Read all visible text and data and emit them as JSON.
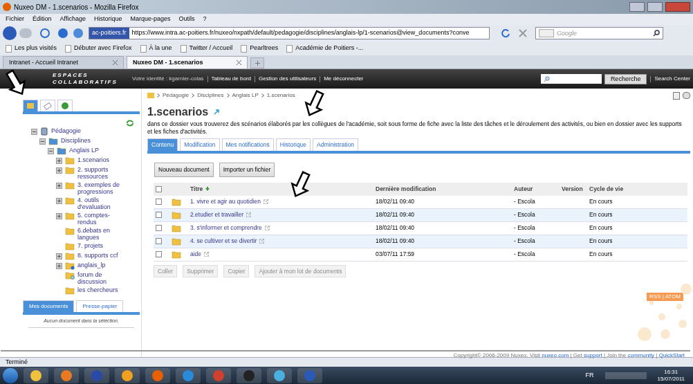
{
  "window": {
    "title": "Nuxeo DM - 1.scenarios - Mozilla Firefox"
  },
  "menu": [
    "Fichier",
    "Édition",
    "Affichage",
    "Historique",
    "Marque-pages",
    "Outils",
    "?"
  ],
  "address": {
    "site": "ac-poitiers.fr",
    "url": "https://www.intra.ac-poitiers.fr/nuxeo/nxpath/default/pedagogie/disciplines/anglais-lp/1-scenarios@view_documents?conve"
  },
  "search": {
    "placeholder": "Google"
  },
  "bookmarks": [
    "Les plus visités",
    "Débuter avec Firefox",
    "À la une",
    "Twitter / Accueil",
    "Pearltrees",
    "Académie de Poitiers -..."
  ],
  "browser_tabs": [
    {
      "label": "Intranet - Accueil Intranet",
      "selected": false
    },
    {
      "label": "Nuxeo DM - 1.scenarios",
      "selected": true
    }
  ],
  "header": {
    "logo": [
      "ESPACES",
      "COLLABORATIFS"
    ],
    "identity": "Votre identité : kgarnier-colas",
    "links": [
      "Tableau de bord",
      "Gestion des utilisateurs",
      "Me déconnecter"
    ],
    "search_button": "Recherche",
    "search_center": "Search Center"
  },
  "sidebar_tabs": [
    {
      "kind": "navigation",
      "selected": true
    },
    {
      "kind": "tags",
      "selected": false
    },
    {
      "kind": "web",
      "selected": false
    }
  ],
  "tree": [
    {
      "label": "Pédagogie",
      "kind": "workspace",
      "expanded": true,
      "children": [
        {
          "label": "Disciplines",
          "kind": "blue",
          "expanded": true,
          "children": [
            {
              "label": "Anglais LP",
              "kind": "blue",
              "expanded": true,
              "children": [
                {
                  "label": "1.scenarios",
                  "kind": "folder",
                  "expanded": false
                },
                {
                  "label": "2. supports ressources",
                  "kind": "folder",
                  "expanded": false
                },
                {
                  "label": "3. exemples de progressions",
                  "kind": "folder",
                  "expanded": false
                },
                {
                  "label": "4. outils d'evaluation",
                  "kind": "folder",
                  "expanded": false
                },
                {
                  "label": "5. comptes-rendus",
                  "kind": "folder",
                  "expanded": false
                },
                {
                  "label": "6.debats en langues",
                  "kind": "folder"
                },
                {
                  "label": "7. projets",
                  "kind": "folder"
                },
                {
                  "label": "8. supports ccf",
                  "kind": "folder",
                  "expanded": false
                },
                {
                  "label": "anglais_lp",
                  "kind": "web",
                  "expanded": false
                },
                {
                  "label": "forum de discussion",
                  "kind": "forum"
                },
                {
                  "label": "les chercheurs",
                  "kind": "folder"
                }
              ]
            }
          ]
        }
      ]
    }
  ],
  "bottom_tabs": [
    {
      "label": "Mes documents",
      "selected": true
    },
    {
      "label": "Presse-papier",
      "selected": false
    }
  ],
  "selection_empty": "Aucun document dans la sélection.",
  "breadcrumb": [
    "Pédagogie",
    "Disciplines",
    "Anglais LP",
    "1.scenarios"
  ],
  "page_title": "1.scenarios",
  "description": "dans ce dossier vous trouverez des scénarios élaborés par les collègues de l'académie, soit sous forme de fiche avec la liste des tâches et le déroulement des activités, ou bien en dossier avec les supports et les fiches d'activités.",
  "content_tabs": [
    {
      "label": "Contenu",
      "selected": true
    },
    {
      "label": "Modification",
      "selected": false
    },
    {
      "label": "Mes notifications",
      "selected": false
    },
    {
      "label": "Historique",
      "selected": false
    },
    {
      "label": "Administration",
      "selected": false
    }
  ],
  "actions": [
    "Nouveau document",
    "Importer un fichier"
  ],
  "table": {
    "select_all_checked": false,
    "columns": [
      "Titre",
      "Dernière modification",
      "Auteur",
      "Version",
      "Cycle de vie"
    ],
    "rows": [
      {
        "title": "1. vivre et agir au quotidien",
        "modified": "18/02/11 09:40",
        "author": "- Escola",
        "state": "En cours",
        "checked": false
      },
      {
        "title": "2.etudier et travailler",
        "modified": "18/02/11 09:40",
        "author": "- Escola",
        "state": "En cours",
        "checked": false
      },
      {
        "title": "3. s'informer et comprendre",
        "modified": "18/02/11 09:40",
        "author": "- Escola",
        "state": "En cours",
        "checked": false
      },
      {
        "title": "4. se cultiver et se divertir",
        "modified": "18/02/11 09:40",
        "author": "- Escola",
        "state": "En cours",
        "checked": false
      },
      {
        "title": "aide",
        "modified": "03/07/11 17:59",
        "author": "- Escola",
        "state": "En cours",
        "checked": false
      }
    ]
  },
  "bulk_buttons": [
    {
      "label": "Coller",
      "disabled": true
    },
    {
      "label": "Supprimer",
      "disabled": true
    },
    {
      "label": "Copier",
      "disabled": true
    },
    {
      "label": "Ajouter à mon lot de documents",
      "disabled": true
    }
  ],
  "feed": "RSS | ATOM",
  "footer": [
    {
      "text": "Copyright© 2006-2009 Nuxeo. Visit ",
      "kind": "text"
    },
    {
      "text": "nuxeo.com",
      "kind": "link"
    },
    {
      "text": " | Get ",
      "kind": "text"
    },
    {
      "text": "support",
      "kind": "link"
    },
    {
      "text": " | Join the ",
      "kind": "text"
    },
    {
      "text": "community",
      "kind": "link"
    },
    {
      "text": " | ",
      "kind": "text"
    },
    {
      "text": "QuickStart",
      "kind": "link"
    }
  ],
  "status_bar": "Terminé",
  "taskbar": {
    "language": "FR",
    "time": "16:31",
    "date": "15/07/2011"
  }
}
